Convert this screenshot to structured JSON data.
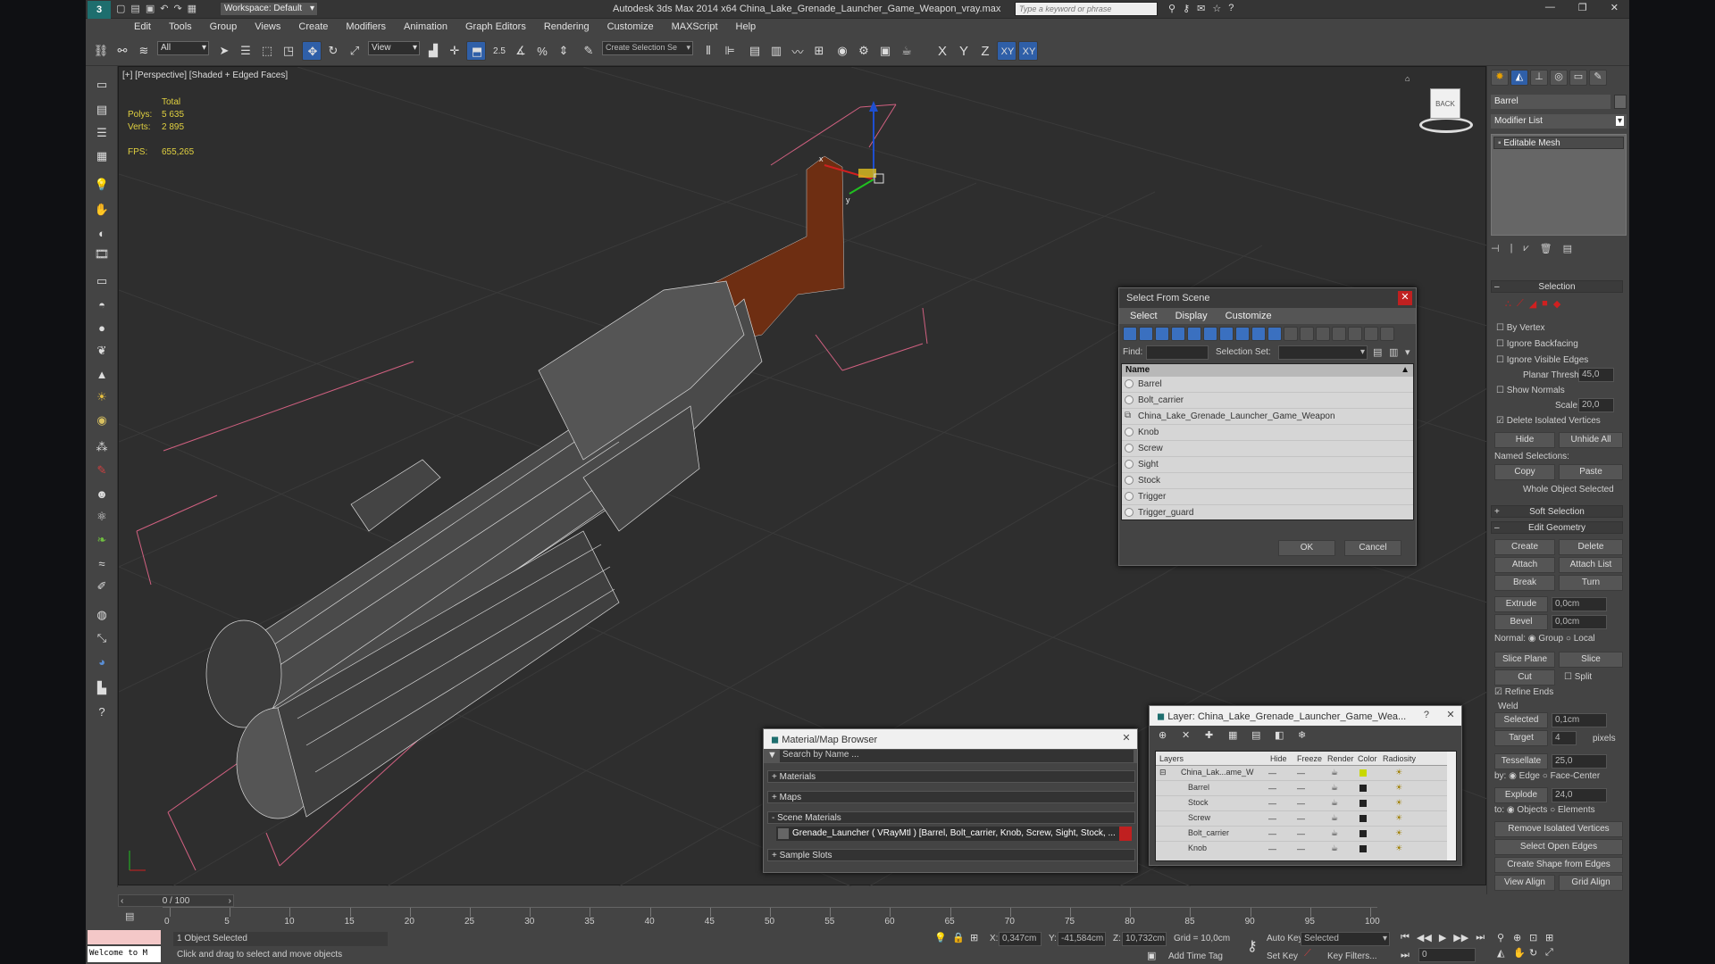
{
  "app": {
    "title": "Autodesk 3ds Max  2014 x64     China_Lake_Grenade_Launcher_Game_Weapon_vray.max",
    "workspace": "Workspace: Default",
    "search_placeholder": "Type a keyword or phrase"
  },
  "menu": [
    "Edit",
    "Tools",
    "Group",
    "Views",
    "Create",
    "Modifiers",
    "Animation",
    "Graph Editors",
    "Rendering",
    "Customize",
    "MAXScript",
    "Help"
  ],
  "toolbar": {
    "filter": "All",
    "refcoord": "View",
    "selset": "Create Selection Se",
    "snap_angle": "2.5",
    "axes": [
      "X",
      "Y",
      "Z",
      "XY",
      "XY"
    ]
  },
  "viewport": {
    "label": "[+] [Perspective] [Shaded + Edged Faces]",
    "stats": {
      "total": "Total",
      "polys_label": "Polys:",
      "polys": "5 635",
      "verts_label": "Verts:",
      "verts": "2 895",
      "fps_label": "FPS:",
      "fps": "655,265"
    },
    "gizmo": {
      "x": "x",
      "y": "y"
    },
    "viewcube": "BACK"
  },
  "select_scene": {
    "title": "Select From Scene",
    "tabs": [
      "Select",
      "Display",
      "Customize"
    ],
    "find_label": "Find:",
    "selset_label": "Selection Set:",
    "col_name": "Name",
    "items": [
      "Barrel",
      "Bolt_carrier",
      "China_Lake_Grenade_Launcher_Game_Weapon",
      "Knob",
      "Screw",
      "Sight",
      "Stock",
      "Trigger",
      "Trigger_guard"
    ],
    "ok": "OK",
    "cancel": "Cancel"
  },
  "material_browser": {
    "title": "Material/Map Browser",
    "search": "Search by Name ...",
    "sections": [
      "+ Materials",
      "+ Maps",
      "- Scene Materials"
    ],
    "scene_material": "Grenade_Launcher  ( VRayMtl ) [Barrel, Bolt_carrier, Knob, Screw, Sight, Stock, ...",
    "sample": "+ Sample Slots"
  },
  "layer_dialog": {
    "title": "Layer: China_Lake_Grenade_Launcher_Game_Wea...",
    "help": "?",
    "cols": [
      "Layers",
      "Hide",
      "Freeze",
      "Render",
      "Color",
      "Radiosity"
    ],
    "rows": [
      "China_Lak...ame_W",
      "Barrel",
      "Stock",
      "Screw",
      "Bolt_carrier",
      "Knob"
    ]
  },
  "command_panel": {
    "object_name": "Barrel",
    "modifier_list": "Modifier List",
    "stack_item": "Editable Mesh",
    "selection": {
      "title": "Selection",
      "by_vertex": "By Vertex",
      "ignore_backfacing": "Ignore Backfacing",
      "ignore_visible": "Ignore Visible Edges",
      "planar_label": "Planar Thresh:",
      "planar": "45,0",
      "show_normals": "Show Normals",
      "scale_label": "Scale:",
      "scale": "20,0",
      "delete_isolated": "Delete Isolated Vertices",
      "hide": "Hide",
      "unhide": "Unhide All",
      "named_sel": "Named Selections:",
      "copy": "Copy",
      "paste": "Paste",
      "whole": "Whole Object Selected"
    },
    "soft_selection": "Soft Selection",
    "edit_geometry": {
      "title": "Edit Geometry",
      "create": "Create",
      "delete": "Delete",
      "attach": "Attach",
      "attach_list": "Attach List",
      "break": "Break",
      "turn": "Turn",
      "extrude": "Extrude",
      "extrude_val": "0,0cm",
      "bevel": "Bevel",
      "bevel_val": "0,0cm",
      "normal_label": "Normal:",
      "group": "Group",
      "local": "Local",
      "slice_plane": "Slice Plane",
      "slice": "Slice",
      "cut": "Cut",
      "split": "Split",
      "refine": "Refine Ends",
      "weld": "Weld",
      "selected": "Selected",
      "selected_val": "0,1cm",
      "target": "Target",
      "target_val": "4",
      "pixels": "pixels",
      "tessellate": "Tessellate",
      "tess_val": "25,0",
      "by_label": "by:",
      "edge": "Edge",
      "face_center": "Face-Center",
      "explode": "Explode",
      "explode_val": "24,0",
      "to_label": "to:",
      "objects": "Objects",
      "elements": "Elements",
      "remove_isolated": "Remove Isolated Vertices",
      "select_open": "Select Open Edges",
      "create_shape": "Create Shape from Edges",
      "view_align": "View Align",
      "grid_align": "Grid Align"
    }
  },
  "timeline": {
    "frame": "0 / 100",
    "ticks": [
      "0",
      "5",
      "10",
      "15",
      "20",
      "25",
      "30",
      "35",
      "40",
      "45",
      "50",
      "55",
      "60",
      "65",
      "70",
      "75",
      "80",
      "85",
      "90",
      "95",
      "100"
    ]
  },
  "status": {
    "maxscript": "Welcome to M",
    "selected": "1 Object Selected",
    "prompt": "Click and drag to select and move objects",
    "x_label": "X:",
    "x": "0,347cm",
    "y_label": "Y:",
    "y": "-41,584cm",
    "z_label": "Z:",
    "z": "10,732cm",
    "grid": "Grid = 10,0cm",
    "autokey": "Auto Key",
    "autokey_val": "Selected",
    "setkey": "Set Key",
    "keyfilters": "Key Filters...",
    "addtime": "Add Time Tag",
    "frame": "0"
  },
  "colors": {
    "accent": "#5a8fd6",
    "selected_blue": "#2f5fa8",
    "red": "#c02020",
    "wood": "#6e2e12"
  }
}
